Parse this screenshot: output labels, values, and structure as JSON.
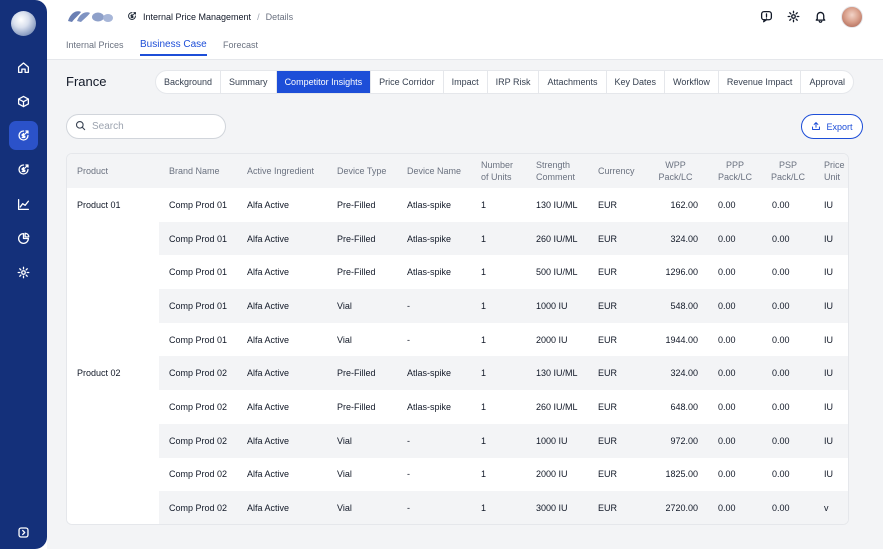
{
  "nav": {
    "items": [
      {
        "name": "home-icon",
        "active": false
      },
      {
        "name": "box-icon",
        "active": false
      },
      {
        "name": "price-target-icon",
        "active": true
      },
      {
        "name": "price-target-alt-icon",
        "active": false
      },
      {
        "name": "chart-line-icon",
        "active": false
      },
      {
        "name": "pie-chart-icon",
        "active": false
      },
      {
        "name": "gear-icon",
        "active": false
      }
    ],
    "collapse_icon": "expand-icon"
  },
  "header": {
    "app_title": "Internal Price Management",
    "separator": "/",
    "page": "Details",
    "icons": [
      "alert-icon",
      "settings-icon",
      "bell-icon",
      "avatar"
    ]
  },
  "main_tabs": [
    {
      "label": "Internal Prices",
      "active": false
    },
    {
      "label": "Business Case",
      "active": true
    },
    {
      "label": "Forecast",
      "active": false
    }
  ],
  "country": "France",
  "sub_tabs": [
    {
      "label": "Background",
      "active": false
    },
    {
      "label": "Summary",
      "active": false
    },
    {
      "label": "Competitor Insights",
      "active": true
    },
    {
      "label": "Price Corridor",
      "active": false
    },
    {
      "label": "Impact",
      "active": false
    },
    {
      "label": "IRP Risk",
      "active": false
    },
    {
      "label": "Attachments",
      "active": false
    },
    {
      "label": "Key Dates",
      "active": false
    },
    {
      "label": "Workflow",
      "active": false
    },
    {
      "label": "Revenue Impact",
      "active": false
    },
    {
      "label": "Approval",
      "active": false
    }
  ],
  "search": {
    "placeholder": "Search",
    "value": ""
  },
  "export_label": "Export",
  "table": {
    "headers": {
      "product": "Product",
      "brand": "Brand Name",
      "ingredient": "Active Ingredient",
      "device_type": "Device Type",
      "device_name": "Device Name",
      "units_1": "Number",
      "units_2": "of Units",
      "strength_1": "Strength",
      "strength_2": "Comment",
      "currency": "Currency",
      "wpp_1": "WPP",
      "wpp_2": "Pack/LC",
      "ppp_1": "PPP",
      "ppp_2": "Pack/LC",
      "psp_1": "PSP",
      "psp_2": "Pack/LC",
      "price_unit_1": "Price",
      "price_unit_2": "Unit"
    },
    "rows": [
      {
        "product": "Product 01",
        "brand": "Comp Prod 01",
        "ingredient": "Alfa Active",
        "device_type": "Pre-Filled",
        "device_name": "Atlas-spike",
        "units": "1",
        "strength": "130 IU/ML",
        "currency": "EUR",
        "wpp": "162.00",
        "ppp": "0.00",
        "psp": "0.00",
        "price_unit": "IU"
      },
      {
        "product": "",
        "brand": "Comp Prod 01",
        "ingredient": "Alfa Active",
        "device_type": "Pre-Filled",
        "device_name": "Atlas-spike",
        "units": "1",
        "strength": "260 IU/ML",
        "currency": "EUR",
        "wpp": "324.00",
        "ppp": "0.00",
        "psp": "0.00",
        "price_unit": "IU"
      },
      {
        "product": "",
        "brand": "Comp Prod 01",
        "ingredient": "Alfa Active",
        "device_type": "Pre-Filled",
        "device_name": "Atlas-spike",
        "units": "1",
        "strength": "500 IU/ML",
        "currency": "EUR",
        "wpp": "1296.00",
        "ppp": "0.00",
        "psp": "0.00",
        "price_unit": "IU"
      },
      {
        "product": "",
        "brand": "Comp Prod 01",
        "ingredient": "Alfa Active",
        "device_type": "Vial",
        "device_name": "-",
        "units": "1",
        "strength": "1000 IU",
        "currency": "EUR",
        "wpp": "548.00",
        "ppp": "0.00",
        "psp": "0.00",
        "price_unit": "IU"
      },
      {
        "product": "",
        "brand": "Comp Prod 01",
        "ingredient": "Alfa Active",
        "device_type": "Vial",
        "device_name": "-",
        "units": "1",
        "strength": "2000 IU",
        "currency": "EUR",
        "wpp": "1944.00",
        "ppp": "0.00",
        "psp": "0.00",
        "price_unit": "IU"
      },
      {
        "product": "Product 02",
        "brand": "Comp Prod 02",
        "ingredient": "Alfa Active",
        "device_type": "Pre-Filled",
        "device_name": "Atlas-spike",
        "units": "1",
        "strength": "130 IU/ML",
        "currency": "EUR",
        "wpp": "324.00",
        "ppp": "0.00",
        "psp": "0.00",
        "price_unit": "IU"
      },
      {
        "product": "",
        "brand": "Comp Prod 02",
        "ingredient": "Alfa Active",
        "device_type": "Pre-Filled",
        "device_name": "Atlas-spike",
        "units": "1",
        "strength": "260 IU/ML",
        "currency": "EUR",
        "wpp": "648.00",
        "ppp": "0.00",
        "psp": "0.00",
        "price_unit": "IU"
      },
      {
        "product": "",
        "brand": "Comp Prod 02",
        "ingredient": "Alfa Active",
        "device_type": "Vial",
        "device_name": "-",
        "units": "1",
        "strength": "1000 IU",
        "currency": "EUR",
        "wpp": "972.00",
        "ppp": "0.00",
        "psp": "0.00",
        "price_unit": "IU"
      },
      {
        "product": "",
        "brand": "Comp Prod 02",
        "ingredient": "Alfa Active",
        "device_type": "Vial",
        "device_name": "-",
        "units": "1",
        "strength": "2000 IU",
        "currency": "EUR",
        "wpp": "1825.00",
        "ppp": "0.00",
        "psp": "0.00",
        "price_unit": "IU"
      },
      {
        "product": "",
        "brand": "Comp Prod 02",
        "ingredient": "Alfa Active",
        "device_type": "Vial",
        "device_name": "-",
        "units": "1",
        "strength": "3000 IU",
        "currency": "EUR",
        "wpp": "2720.00",
        "ppp": "0.00",
        "psp": "0.00",
        "price_unit": "v"
      }
    ]
  },
  "colors": {
    "sidebar": "#14307a",
    "accent": "#1d4ed8",
    "background": "#f3f4f6"
  }
}
